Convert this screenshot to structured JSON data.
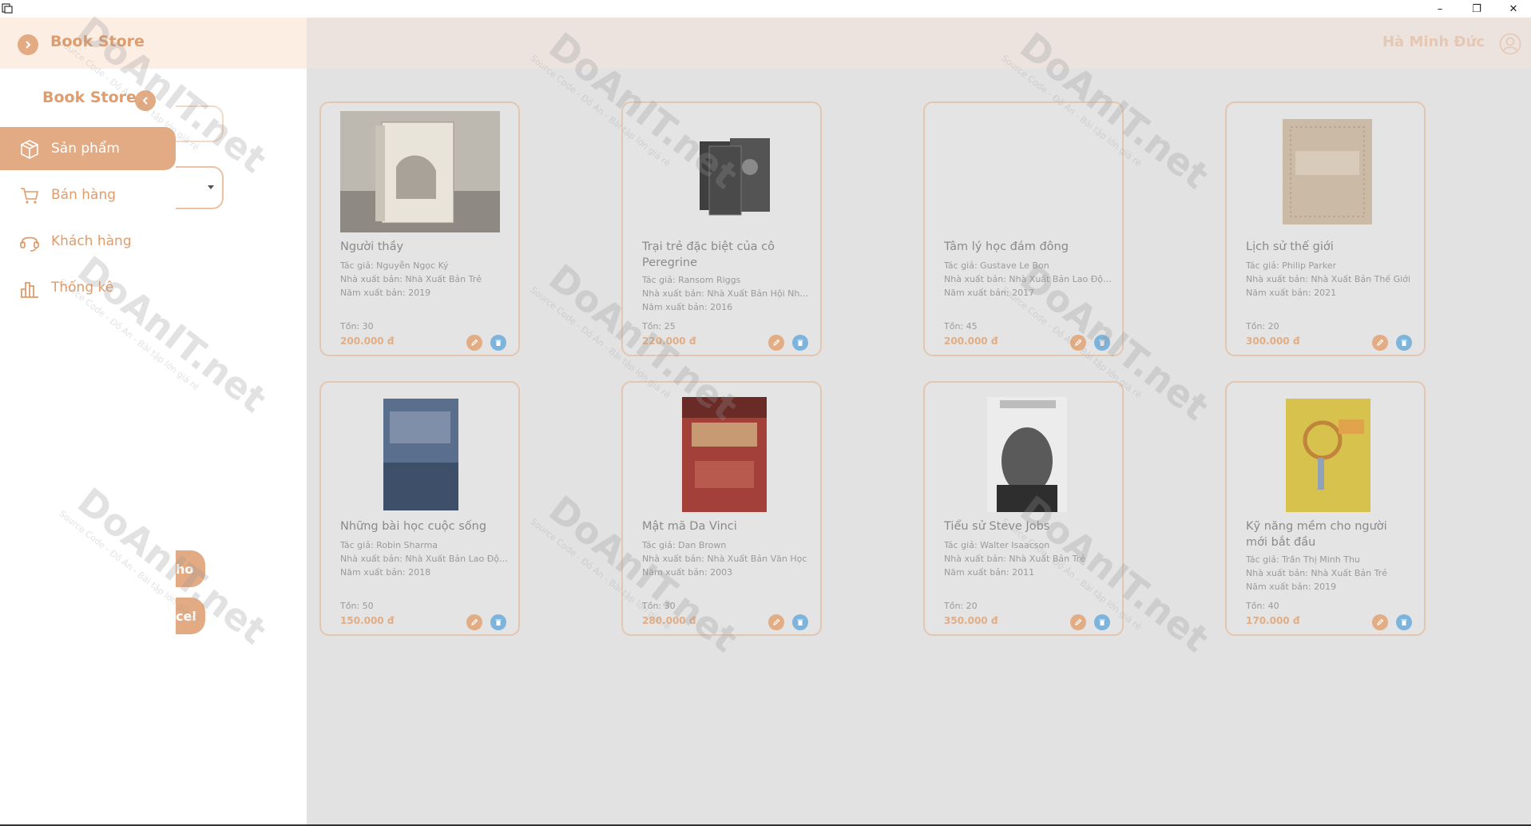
{
  "window": {
    "controls": {
      "minimize": "–",
      "maximize": "❐",
      "close": "✕"
    }
  },
  "header": {
    "brand": "Book Store",
    "user_name": "Hà Minh Đức"
  },
  "sidebar": {
    "brand": "Book Store",
    "nav": [
      {
        "label": "Sản phẩm",
        "icon": "box-icon",
        "active": true
      },
      {
        "label": "Bán hàng",
        "icon": "cart-icon",
        "active": false
      },
      {
        "label": "Khách hàng",
        "icon": "headset-icon",
        "active": false
      },
      {
        "label": "Thống kê",
        "icon": "bar-chart-icon",
        "active": false
      }
    ],
    "ghost_button_1": "ho",
    "ghost_button_2": "cel"
  },
  "watermark": {
    "text": "DoAnIT.net",
    "sub": "Source Code - Đồ Án - Bài tập lớn giá rẻ"
  },
  "products": [
    {
      "title": "Người thầy",
      "author": "Tác giả: Nguyễn Ngọc Ký",
      "publisher": "Nhà xuất bản: Nhà Xuất Bản Trẻ",
      "year": "Năm xuất bản: 2019",
      "stock": "Tồn: 30",
      "price": "200.000 đ",
      "cover_color": "#b9b4ad"
    },
    {
      "title": "Trại trẻ đặc biệt của cô Peregrine",
      "author": "Tác giả: Ransom Riggs",
      "publisher": "Nhà xuất bản: Nhà Xuất Bản Hội Nhà...",
      "year": "Năm xuất bản: 2016",
      "stock": "Tồn: 25",
      "price": "220.000 đ",
      "cover_color": "#4a4a4a"
    },
    {
      "title": "Tâm lý học đám đông",
      "author": "Tác giả: Gustave Le Bon",
      "publisher": "Nhà xuất bản: Nhà Xuất Bản Lao Động",
      "year": "Năm xuất bản: 2017",
      "stock": "Tồn: 45",
      "price": "200.000 đ",
      "cover_color": ""
    },
    {
      "title": "Lịch sử thế giới",
      "author": "Tác giả: Philip Parker",
      "publisher": "Nhà xuất bản: Nhà Xuất Bản Thế Giới",
      "year": "Năm xuất bản: 2021",
      "stock": "Tồn: 20",
      "price": "300.000 đ",
      "cover_color": "#cdbba7"
    },
    {
      "title": "Những bài học cuộc sống",
      "author": "Tác giả: Robin Sharma",
      "publisher": "Nhà xuất bản: Nhà Xuất Bản Lao Động",
      "year": "Năm xuất bản: 2018",
      "stock": "Tồn: 50",
      "price": "150.000 đ",
      "cover_color": "#54698a"
    },
    {
      "title": "Mật mã Da Vinci",
      "author": "Tác giả: Dan Brown",
      "publisher": "Nhà xuất bản: Nhà Xuất Bản Văn Học",
      "year": "Năm xuất bản: 2003",
      "stock": "Tồn: 30",
      "price": "280.000 đ",
      "cover_color": "#a83a34"
    },
    {
      "title": "Tiểu sử Steve Jobs",
      "author": "Tác giả: Walter Isaacson",
      "publisher": "Nhà xuất bản: Nhà Xuất Bản Trẻ",
      "year": "Năm xuất bản: 2011",
      "stock": "Tồn: 20",
      "price": "350.000 đ",
      "cover_color": "#6a6a6a"
    },
    {
      "title": "Kỹ năng mềm cho người mới bắt đầu",
      "author": "Tác giả: Trần Thị Minh Thu",
      "publisher": "Nhà xuất bản: Nhà Xuất Bản Trẻ",
      "year": "Năm xuất bản: 2019",
      "stock": "Tồn: 40",
      "price": "170.000 đ",
      "cover_color": "#d8c24e"
    }
  ]
}
